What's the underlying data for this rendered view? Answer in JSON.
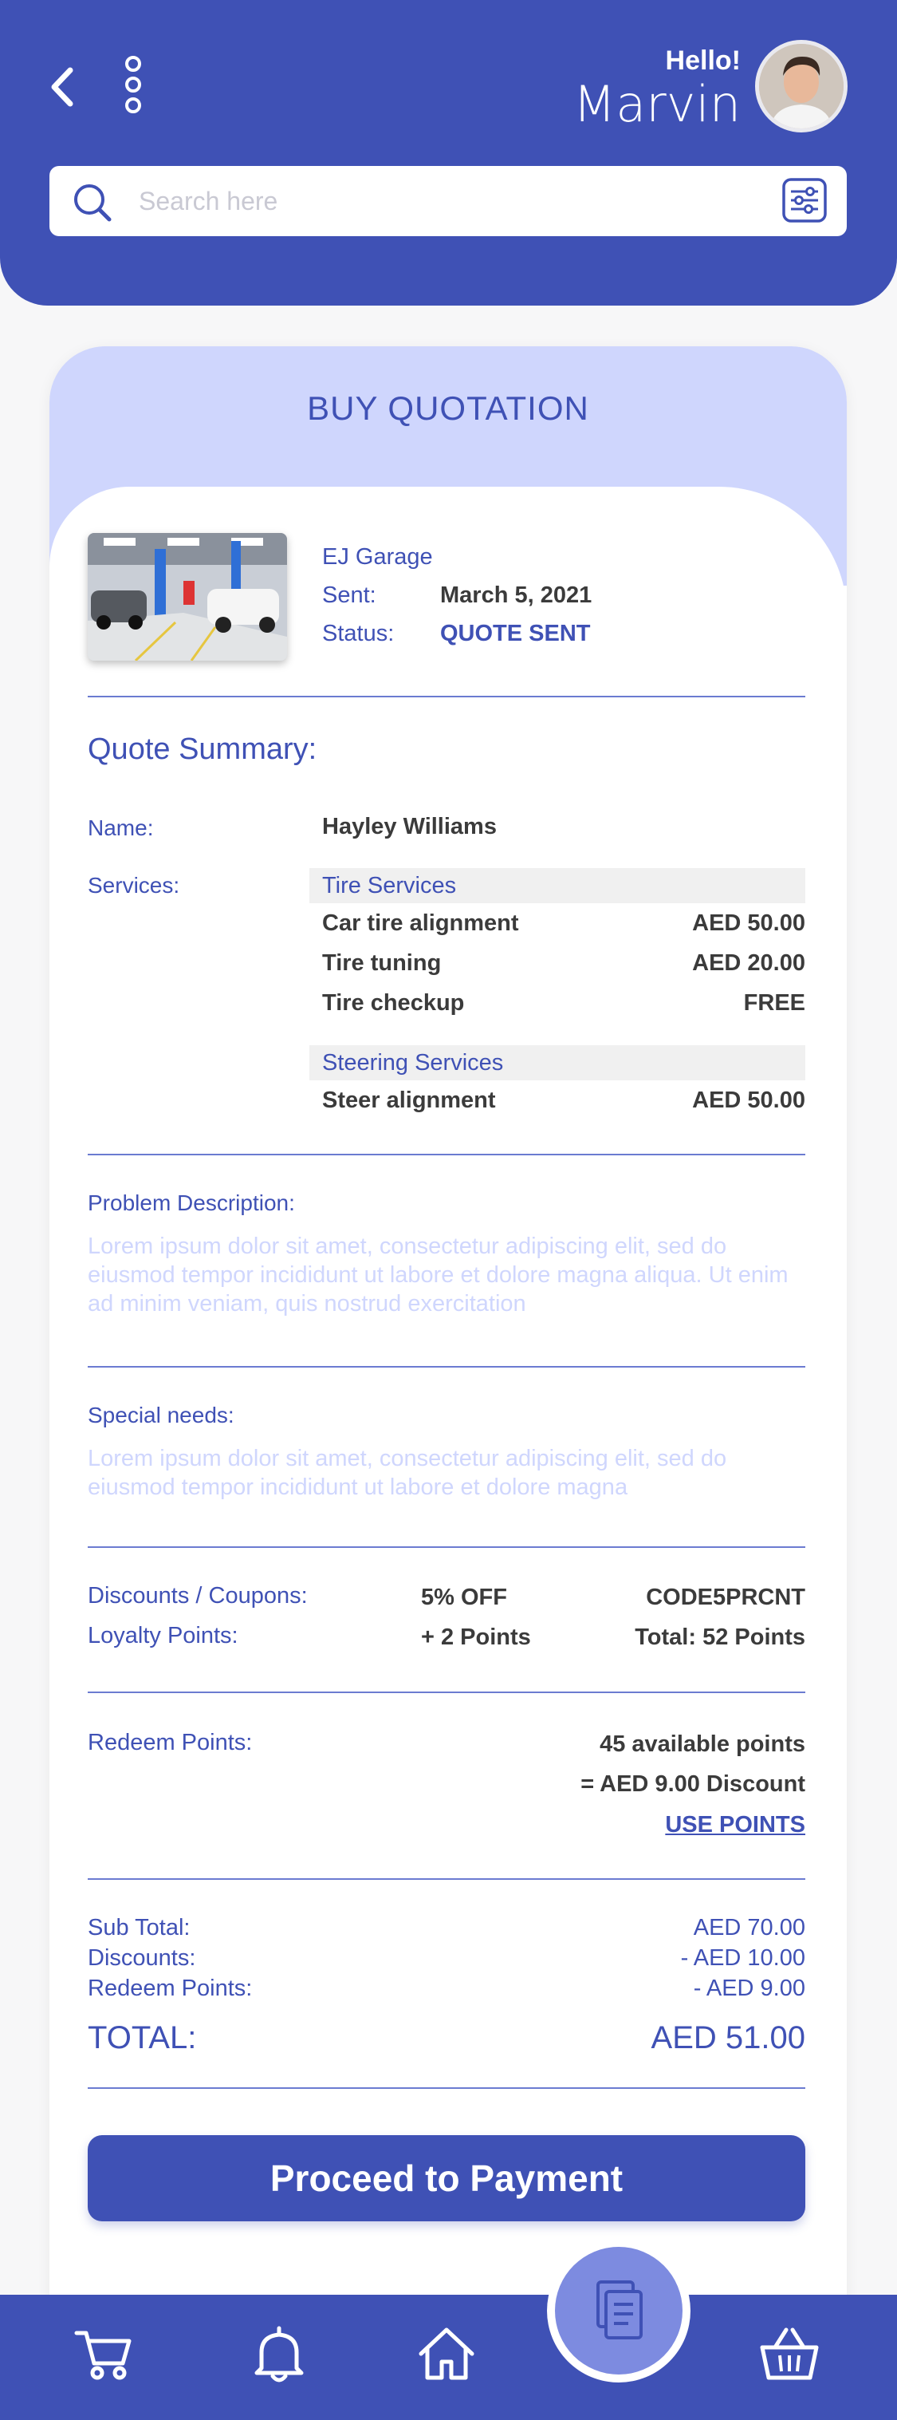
{
  "header": {
    "greeting": "Hello!",
    "user_name": "Marvin",
    "search_placeholder": "Search here"
  },
  "card": {
    "title": "BUY QUOTATION",
    "garage": {
      "name": "EJ Garage",
      "sent_label": "Sent:",
      "sent_value": "March 5, 2021",
      "status_label": "Status:",
      "status_value": "QUOTE SENT"
    },
    "summary_title": "Quote Summary:",
    "name_label": "Name:",
    "name_value": "Hayley Williams",
    "services_label": "Services:",
    "service_groups": [
      {
        "title": "Tire Services",
        "items": [
          {
            "name": "Car tire alignment",
            "price": "AED 50.00"
          },
          {
            "name": "Tire tuning",
            "price": "AED 20.00"
          },
          {
            "name": "Tire checkup",
            "price": "FREE"
          }
        ]
      },
      {
        "title": "Steering Services",
        "items": [
          {
            "name": "Steer alignment",
            "price": "AED 50.00"
          }
        ]
      }
    ],
    "problem_label": "Problem Description:",
    "problem_text": "Lorem ipsum dolor sit amet, consectetur adipiscing elit, sed do eiusmod tempor incididunt ut labore et dolore magna aliqua. Ut enim ad minim veniam, quis nostrud exercitation",
    "special_label": "Special needs:",
    "special_text": "Lorem ipsum dolor sit amet, consectetur adipiscing elit, sed do eiusmod tempor incididunt ut labore et dolore magna",
    "discounts_label": "Discounts / Coupons:",
    "discounts_value": "5% OFF",
    "coupon_code": "CODE5PRCNT",
    "loyalty_label": "Loyalty Points:",
    "loyalty_value": "+ 2 Points",
    "loyalty_total": "Total:  52 Points",
    "redeem_label": "Redeem Points:",
    "available_points": "45 available points",
    "points_discount": "= AED 9.00 Discount",
    "use_points": "USE POINTS",
    "subtotal_label": "Sub Total:",
    "subtotal_value": "AED 70.00",
    "disc_label": "Discounts:",
    "disc_value": "- AED 10.00",
    "redeem_row_label": "Redeem Points:",
    "redeem_row_value": "- AED 9.00",
    "total_label": "TOTAL:",
    "total_value": "AED 51.00",
    "proceed_button": "Proceed to Payment"
  },
  "nav": {
    "items": [
      "cart-icon",
      "bell-icon",
      "home-icon",
      "document-icon",
      "basket-icon"
    ],
    "active": "document-icon"
  },
  "colors": {
    "primary": "#3f51b5",
    "light": "#cfd6fd",
    "placeholder_text": "#cfd6fd"
  }
}
